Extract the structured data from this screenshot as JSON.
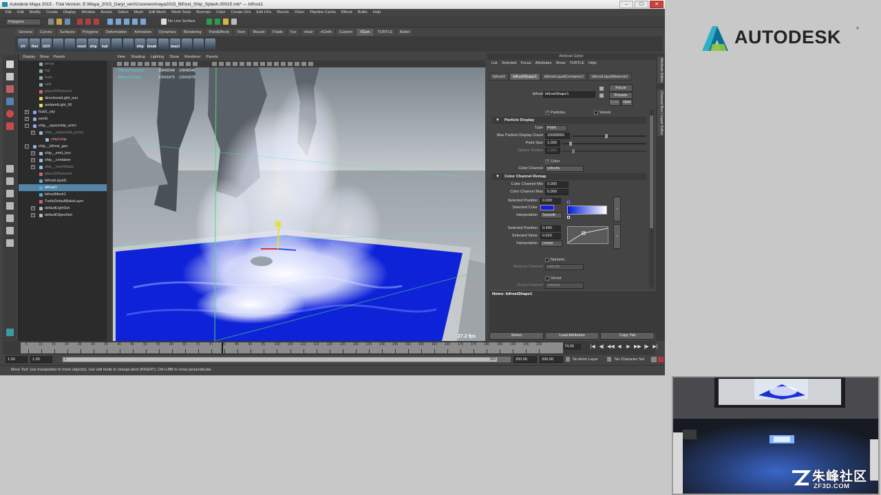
{
  "window": {
    "title": "Autodesk Maya 2015 - Trial Version: E:\\Maya_2015_Daryl_ver01\\scenes\\maya2015_Bifrost_Ship_Splash.00015.mb* --- bifrost1",
    "minimize": "–",
    "maximize": "☐",
    "close": "✕"
  },
  "menubar": [
    "File",
    "Edit",
    "Modify",
    "Create",
    "Display",
    "Window",
    "Assets",
    "Select",
    "Mesh",
    "Edit Mesh",
    "Mesh Tools",
    "Normals",
    "Color",
    "Create UVs",
    "Edit UVs",
    "Muscle",
    "XGen",
    "Pipeline Cache",
    "Bifrost",
    "Bullet",
    "Help"
  ],
  "statusline": {
    "mode": "Polygons",
    "live_surface": "No Live Surface"
  },
  "shelf_tabs": [
    "General",
    "Curves",
    "Surfaces",
    "Polygons",
    "Deformation",
    "Animation",
    "Dynamics",
    "Rendering",
    "PaintEffects",
    "Toon",
    "Muscle",
    "Fluids",
    "Fur",
    "nHair",
    "nCloth",
    "Custom",
    "XGen",
    "TURTLE",
    "Bullet"
  ],
  "shelf_active_tab": "XGen",
  "shelf_buttons": [
    "UV",
    "Hist",
    "GOV",
    "",
    "",
    "voxel",
    "ship",
    "hair",
    "",
    "",
    "ship",
    "break",
    "",
    "beacl",
    "",
    "",
    ""
  ],
  "outliner": {
    "menu": [
      "Display",
      "Show",
      "Panels"
    ],
    "rows": [
      {
        "label": "persp",
        "indent": 1,
        "kind": "cam",
        "state": "dim"
      },
      {
        "label": "top",
        "indent": 1,
        "kind": "cam",
        "state": "dim"
      },
      {
        "label": "front",
        "indent": 1,
        "kind": "cam",
        "state": "dim"
      },
      {
        "label": "side",
        "indent": 1,
        "kind": "cam",
        "state": "dim"
      },
      {
        "label": "place3dTexture1",
        "indent": 1,
        "kind": "tex",
        "state": "dim"
      },
      {
        "label": "directionalLight_sun",
        "indent": 1,
        "kind": "light",
        "state": ""
      },
      {
        "label": "ambientLight_fill",
        "indent": 1,
        "kind": "light",
        "state": ""
      },
      {
        "label": "fluid1_sky",
        "indent": 0,
        "kind": "fluid",
        "state": "",
        "expand": "+"
      },
      {
        "label": "world",
        "indent": 0,
        "kind": "grp",
        "state": "",
        "expand": "+"
      },
      {
        "label": "ship__spaceship_anim",
        "indent": 0,
        "kind": "grp",
        "state": "",
        "expand": "−"
      },
      {
        "label": "ship__spaceship_proxy",
        "indent": 1,
        "kind": "mesh",
        "state": "dim",
        "expand": "+"
      },
      {
        "label": "ship1ship",
        "indent": 2,
        "kind": "mesh",
        "state": "hot"
      },
      {
        "label": "ship__bifrost_geo",
        "indent": 0,
        "kind": "grp",
        "state": "",
        "expand": "−"
      },
      {
        "label": "ship__emit_box",
        "indent": 1,
        "kind": "mesh",
        "state": "",
        "expand": "+"
      },
      {
        "label": "ship__container",
        "indent": 1,
        "kind": "mesh",
        "state": "",
        "expand": "+"
      },
      {
        "label": "ship__meshMask",
        "indent": 1,
        "kind": "mesh",
        "state": "dim",
        "expand": "+"
      },
      {
        "label": "place3dTexture4",
        "indent": 1,
        "kind": "tex",
        "state": "dim"
      },
      {
        "label": "bifrostLiquid1",
        "indent": 1,
        "kind": "bif",
        "state": ""
      },
      {
        "label": "bifrost1",
        "indent": 1,
        "kind": "bif",
        "state": "sel"
      },
      {
        "label": "bifrostMesh1",
        "indent": 1,
        "kind": "bif",
        "state": ""
      },
      {
        "label": "TurtleDefaultBakeLayer",
        "indent": 1,
        "kind": "tex",
        "state": ""
      },
      {
        "label": "defaultLightSet",
        "indent": 1,
        "kind": "set",
        "state": "",
        "expand": "+"
      },
      {
        "label": "defaultObjectSet",
        "indent": 1,
        "kind": "set",
        "state": "",
        "expand": "+"
      }
    ]
  },
  "viewport": {
    "menu": [
      "View",
      "Shading",
      "Lighting",
      "Show",
      "Renderer",
      "Panels"
    ],
    "hud": [
      {
        "label": "Bifrost Particles",
        "v1": "10848348",
        "v2": "10848348"
      },
      {
        "label": "Bifrost Voxels",
        "v1": "12041875",
        "v2": "12041875"
      }
    ],
    "fps": "27.2 fps"
  },
  "attribute_editor": {
    "title": "Attribute Editor",
    "menu": [
      "List",
      "Selected",
      "Focus",
      "Attributes",
      "Show",
      "TURTLE",
      "Help"
    ],
    "tabs": [
      "bifrost1",
      "bifrostShape1",
      "bifrostLiquidContainer1",
      "bifrostLiquidMaterial1"
    ],
    "active_tab": "bifrostShape1",
    "node_label": "bifrostShape:",
    "node_value": "bifrostShape1",
    "focus_btn": "Focus",
    "presets_btn": "Presets",
    "show_btn": "Show",
    "hide_btn": "Hide",
    "particles_label": "Particles",
    "voxels_label": "Voxels",
    "particle_display": {
      "header": "Particle Display",
      "type_label": "Type",
      "type_value": "Point",
      "max_count_label": "Max Particle Display Count",
      "max_count_value": "10000000",
      "point_size_label": "Point Size",
      "point_size_value": "1.000",
      "sphere_radius_label": "Sphere Radius",
      "sphere_radius_value": "1.000",
      "color_label": "Color",
      "color_channel_label": "Color Channel",
      "color_channel_value": "velocity"
    },
    "remap": {
      "header": "Color Channel Remap",
      "min_label": "Color Channel Min",
      "min_value": "0.000",
      "max_label": "Color Channel Max",
      "max_value": "5.000",
      "sel_pos_label": "Selected Position",
      "sel_pos_value": "0.000",
      "sel_color_label": "Selected Color",
      "sel_color": "#1520d8",
      "interp_label": "Interpolation",
      "interp_value": "Smooth",
      "sel_pos2_label": "Selected Position",
      "sel_pos2_value": "0.400",
      "sel_val_label": "Selected Value",
      "sel_val_value": "0.620",
      "interp2_label": "Interpolation",
      "interp2_value": "Linear",
      "expand_btn": "›"
    },
    "numeric_label": "Numeric",
    "numeric_channel_label": "Numeric Channel",
    "numeric_channel_value": "velocity",
    "vector_label": "Vector",
    "vector_channel_label": "Vector Channel",
    "vector_channel_value": "velocity",
    "notes_label": "Notes: bifrostShape1",
    "buttons": [
      "Select",
      "Load Attributes",
      "Copy Tab"
    ]
  },
  "side_tabs": [
    "Attribute Editor",
    "Channel Box / Layer Editor"
  ],
  "timeline": {
    "ticks": [
      "5",
      "10",
      "15",
      "20",
      "25",
      "30",
      "35",
      "40",
      "45",
      "50",
      "55",
      "60",
      "65",
      "70",
      "75",
      "80",
      "85",
      "90",
      "95",
      "100",
      "105",
      "110",
      "115",
      "120",
      "125",
      "130",
      "135",
      "140",
      "145",
      "150",
      "155",
      "160",
      "165",
      "170",
      "175",
      "180",
      "185",
      "190",
      "195",
      "200"
    ],
    "current_frame": "74.00",
    "current_position_fraction": 0.37,
    "playback": [
      "|◀",
      "◀|",
      "◀◀",
      "◀",
      "▶",
      "▶▶",
      "|▶",
      "▶|"
    ]
  },
  "range": {
    "start": "1.00",
    "start2": "1.00",
    "inner_start": "1",
    "inner_end": "200",
    "end": "200.00",
    "end2": "200.00",
    "anim_layer": "No Anim Layer",
    "char_set": "No Character Set"
  },
  "helpline": "Move Tool: Use manipulator to move object(s). Use edit mode to change pivot (INSERT). Ctrl+LMB to move perpendicular.",
  "brand": {
    "logo_text": "AUTODESK",
    "tm": "®",
    "logo_colors": [
      "#2fb0c6",
      "#0b6e93",
      "#8cc63f"
    ]
  },
  "watermark": {
    "main": "朱峰社区",
    "sub": "ZF3D.COM"
  }
}
